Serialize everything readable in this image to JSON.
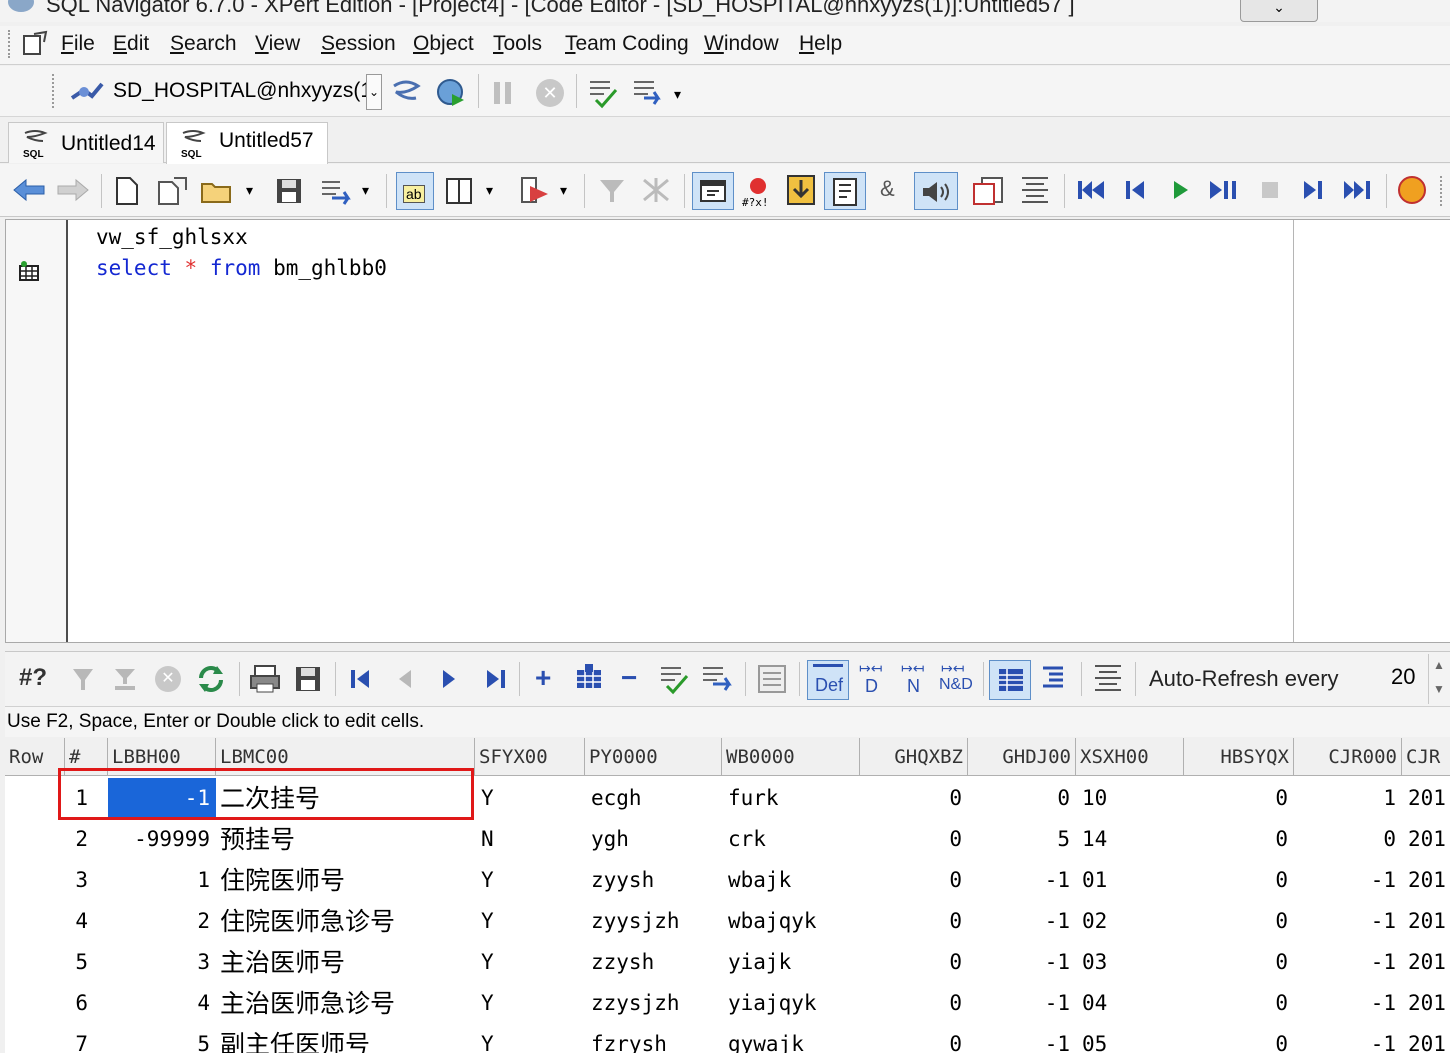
{
  "window": {
    "title": "SQL Navigator 6.7.0 - XPert Edition - [Project4] - [Code Editor - [SD_HOSPITAL@nhxyyzs(1)]:Untitled57 ]"
  },
  "menu": [
    "File",
    "Edit",
    "Search",
    "View",
    "Session",
    "Object",
    "Tools",
    "Team Coding",
    "Window",
    "Help"
  ],
  "connection": {
    "label": "SD_HOSPITAL@nhxyyzs(1)"
  },
  "tabs": [
    {
      "label": "Untitled14",
      "icon": "sql-file-icon"
    },
    {
      "label": "Untitled57",
      "icon": "sql-file-icon",
      "active": true
    }
  ],
  "editor": {
    "line1": "vw_sf_ghlsxx",
    "line2_kw1": "select",
    "line2_star": "*",
    "line2_kw2": "from",
    "line2_rest": "bm_ghlbb0"
  },
  "grid_toolbar": {
    "count_label": "#?",
    "def_label": "Def",
    "d_label": "D",
    "n_label": "N",
    "nd_label": "N&D",
    "auto_refresh_label": "Auto-Refresh every",
    "auto_refresh_value": "20"
  },
  "hint": "Use F2, Space, Enter or Double click to edit cells.",
  "grid": {
    "headers": [
      "Row",
      "#",
      "LBBH00",
      "LBMC00",
      "SFYX00",
      "PY0000",
      "WB0000",
      "GHQXBZ",
      "GHDJ00",
      "XSXH00",
      "HBSYQX",
      "CJR000",
      "CJR"
    ],
    "rows": [
      {
        "row": "1",
        "lbbh": "-1",
        "lbmc": "二次挂号",
        "sfyx": "Y",
        "py": "ecgh",
        "wb": "furk",
        "ghqxbz": "0",
        "ghdj": "0",
        "xsxh": "10",
        "hbsyqx": "0",
        "cjr": "1",
        "cjr2": "201"
      },
      {
        "row": "2",
        "lbbh": "-99999",
        "lbmc": "预挂号",
        "sfyx": "N",
        "py": "ygh",
        "wb": "crk",
        "ghqxbz": "0",
        "ghdj": "5",
        "xsxh": "14",
        "hbsyqx": "0",
        "cjr": "0",
        "cjr2": "201"
      },
      {
        "row": "3",
        "lbbh": "1",
        "lbmc": "住院医师号",
        "sfyx": "Y",
        "py": "zyysh",
        "wb": "wbajk",
        "ghqxbz": "0",
        "ghdj": "-1",
        "xsxh": "01",
        "hbsyqx": "0",
        "cjr": "-1",
        "cjr2": "201"
      },
      {
        "row": "4",
        "lbbh": "2",
        "lbmc": "住院医师急诊号",
        "sfyx": "Y",
        "py": "zyysjzh",
        "wb": "wbajqyk",
        "ghqxbz": "0",
        "ghdj": "-1",
        "xsxh": "02",
        "hbsyqx": "0",
        "cjr": "-1",
        "cjr2": "201"
      },
      {
        "row": "5",
        "lbbh": "3",
        "lbmc": "主治医师号",
        "sfyx": "Y",
        "py": "zzysh",
        "wb": "yiajk",
        "ghqxbz": "0",
        "ghdj": "-1",
        "xsxh": "03",
        "hbsyqx": "0",
        "cjr": "-1",
        "cjr2": "201"
      },
      {
        "row": "6",
        "lbbh": "4",
        "lbmc": "主治医师急诊号",
        "sfyx": "Y",
        "py": "zzysjzh",
        "wb": "yiajqyk",
        "ghqxbz": "0",
        "ghdj": "-1",
        "xsxh": "04",
        "hbsyqx": "0",
        "cjr": "-1",
        "cjr2": "201"
      },
      {
        "row": "7",
        "lbbh": "5",
        "lbmc": "副主任医师号",
        "sfyx": "Y",
        "py": "fzrysh",
        "wb": "gywajk",
        "ghqxbz": "0",
        "ghdj": "-1",
        "xsxh": "05",
        "hbsyqx": "0",
        "cjr": "-1",
        "cjr2": "201"
      }
    ]
  },
  "colors": {
    "keyword": "#1428d2",
    "selection": "#1a66d9",
    "highlight_box": "#e01818"
  }
}
